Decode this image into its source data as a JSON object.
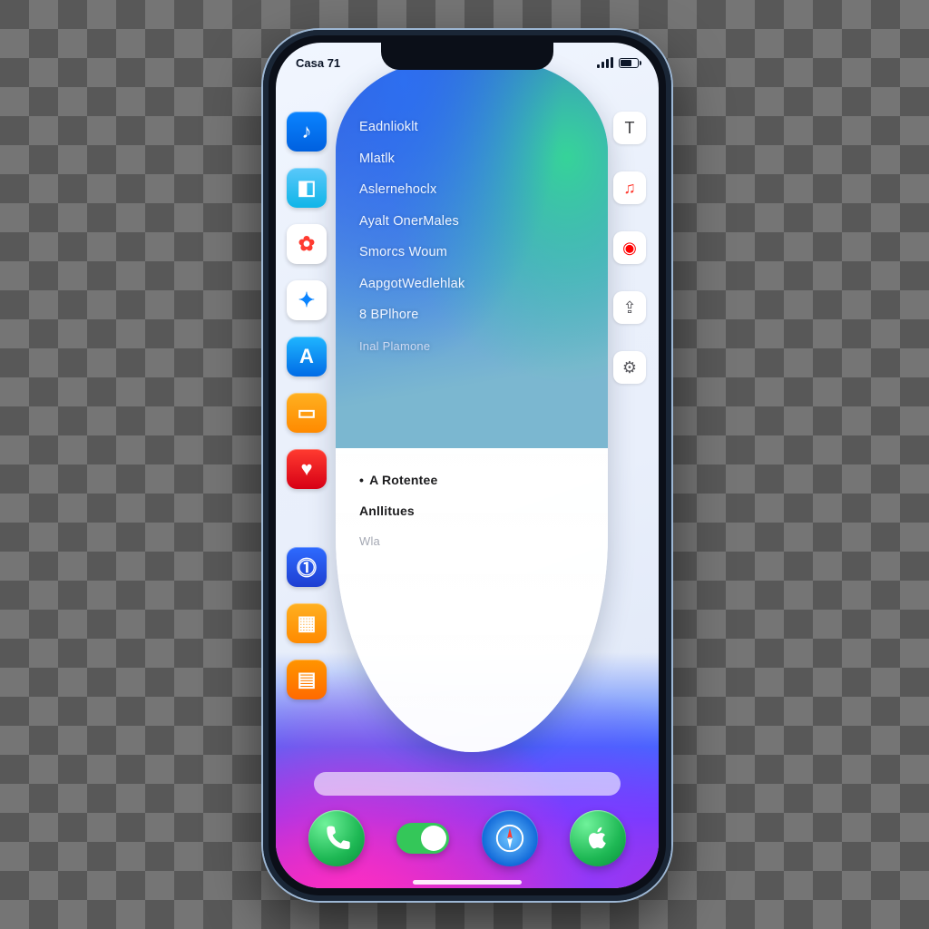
{
  "statusbar": {
    "time": "Casa 71"
  },
  "card": {
    "top_items": [
      {
        "label": "Eadnlioklt",
        "dim": false
      },
      {
        "label": "Mlatlk",
        "dim": false
      },
      {
        "label": "Aslernehoclx",
        "dim": false
      },
      {
        "label": "Ayalt OnerMales",
        "dim": false
      },
      {
        "label": "Smorcs Woum",
        "dim": false
      },
      {
        "label": "AapgotWedlehlak",
        "dim": false
      },
      {
        "label": "8 BPlhore",
        "dim": false
      },
      {
        "label": "Inal Plamone",
        "dim": true
      }
    ],
    "bottom_items": [
      {
        "label": "A Rotentee",
        "lead": true,
        "dim": false
      },
      {
        "label": "Anllitues",
        "lead": false,
        "dim": false
      },
      {
        "label": "Wla",
        "lead": false,
        "dim": true
      }
    ]
  },
  "left_rail": [
    {
      "name": "music-app-icon",
      "bg": "linear-gradient(180deg,#0a84ff,#0060df)",
      "glyph": "♪"
    },
    {
      "name": "files-app-icon",
      "bg": "linear-gradient(180deg,#5ac8fa,#0fb5e8)",
      "glyph": "◧"
    },
    {
      "name": "photos-app-icon",
      "bg": "#ffffff",
      "glyph": "✿",
      "fg": "#ff3b30"
    },
    {
      "name": "safari-app-icon",
      "bg": "#ffffff",
      "glyph": "✦",
      "fg": "#0a84ff"
    },
    {
      "name": "appstore-app-icon",
      "bg": "linear-gradient(180deg,#1fb6ff,#006be6)",
      "glyph": "A"
    },
    {
      "name": "notes-app-icon",
      "bg": "linear-gradient(180deg,#ffb020,#ff8a00)",
      "glyph": "▭"
    },
    {
      "name": "health-app-icon",
      "bg": "linear-gradient(180deg,#ff3b30,#d70015)",
      "glyph": "♥"
    },
    {
      "name": "gap",
      "bg": "",
      "glyph": ""
    },
    {
      "name": "fitness-app-icon",
      "bg": "linear-gradient(180deg,#2e6bff,#1e3fd1)",
      "glyph": "⓵"
    },
    {
      "name": "calendar-app-icon",
      "bg": "linear-gradient(180deg,#ffb020,#ff8a00)",
      "glyph": "▦"
    },
    {
      "name": "books-app-icon",
      "bg": "linear-gradient(180deg,#ff9500,#ff6a00)",
      "glyph": "▤"
    }
  ],
  "right_rail": [
    {
      "name": "text-tool-icon",
      "glyph": "T",
      "fg": "#3a3a3c"
    },
    {
      "name": "music-widget-icon",
      "glyph": "♫",
      "fg": "#ff3b30"
    },
    {
      "name": "record-icon",
      "glyph": "◉",
      "fg": "#ff0000"
    },
    {
      "name": "share-icon",
      "glyph": "⇪",
      "fg": "#5b5b60"
    },
    {
      "name": "settings-icon",
      "glyph": "⚙",
      "fg": "#5b5b60"
    }
  ],
  "dock": [
    {
      "name": "phone-app-icon",
      "bg": "radial-gradient(circle at 30% 25%, #6ff29a, #1eb854 60%, #0a8f3c)",
      "glyph": "phone"
    },
    {
      "name": "toggle-switch",
      "bg": "",
      "glyph": "toggle"
    },
    {
      "name": "safari-dock-icon",
      "bg": "radial-gradient(circle at 50% 50%, #6cc4ff, #0a62d6 75%)",
      "glyph": "compass"
    },
    {
      "name": "apple-app-icon",
      "bg": "radial-gradient(circle at 30% 25%, #6ff29a, #1eb854 60%, #0a8f3c)",
      "glyph": "apple"
    }
  ]
}
